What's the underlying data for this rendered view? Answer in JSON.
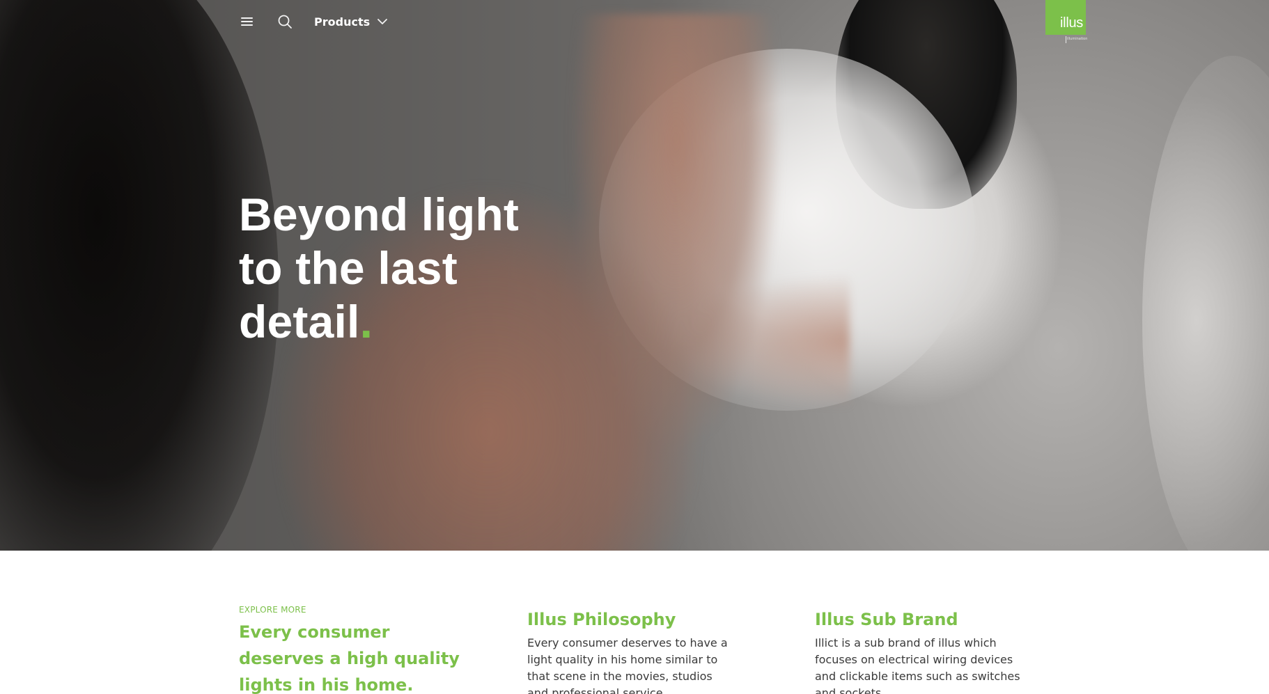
{
  "nav": {
    "products_label": "Products",
    "icons": {
      "menu": "hamburger-menu-icon",
      "search": "search-icon",
      "dropdown": "chevron-down-icon"
    }
  },
  "brand": {
    "logo_text": "illus",
    "tagline": "illumination",
    "accent_color": "#7cc04a"
  },
  "hero": {
    "headline": "Beyond light to the last detail",
    "headline_suffix": "."
  },
  "sections": {
    "explore": {
      "eyebrow": "EXPLORE MORE",
      "lead": "Every consumer deserves a high quality lights in his home."
    },
    "philosophy": {
      "title": "Illus Philosophy",
      "body": "Every consumer deserves to have a light quality in his home similar to that scene in the movies, studios and professional service organizations."
    },
    "sub_brand": {
      "title": "Illus Sub Brand",
      "body": "Illict is a sub brand of illus which focuses on electrical wiring devices and clickable items such as switches and sockets."
    }
  }
}
